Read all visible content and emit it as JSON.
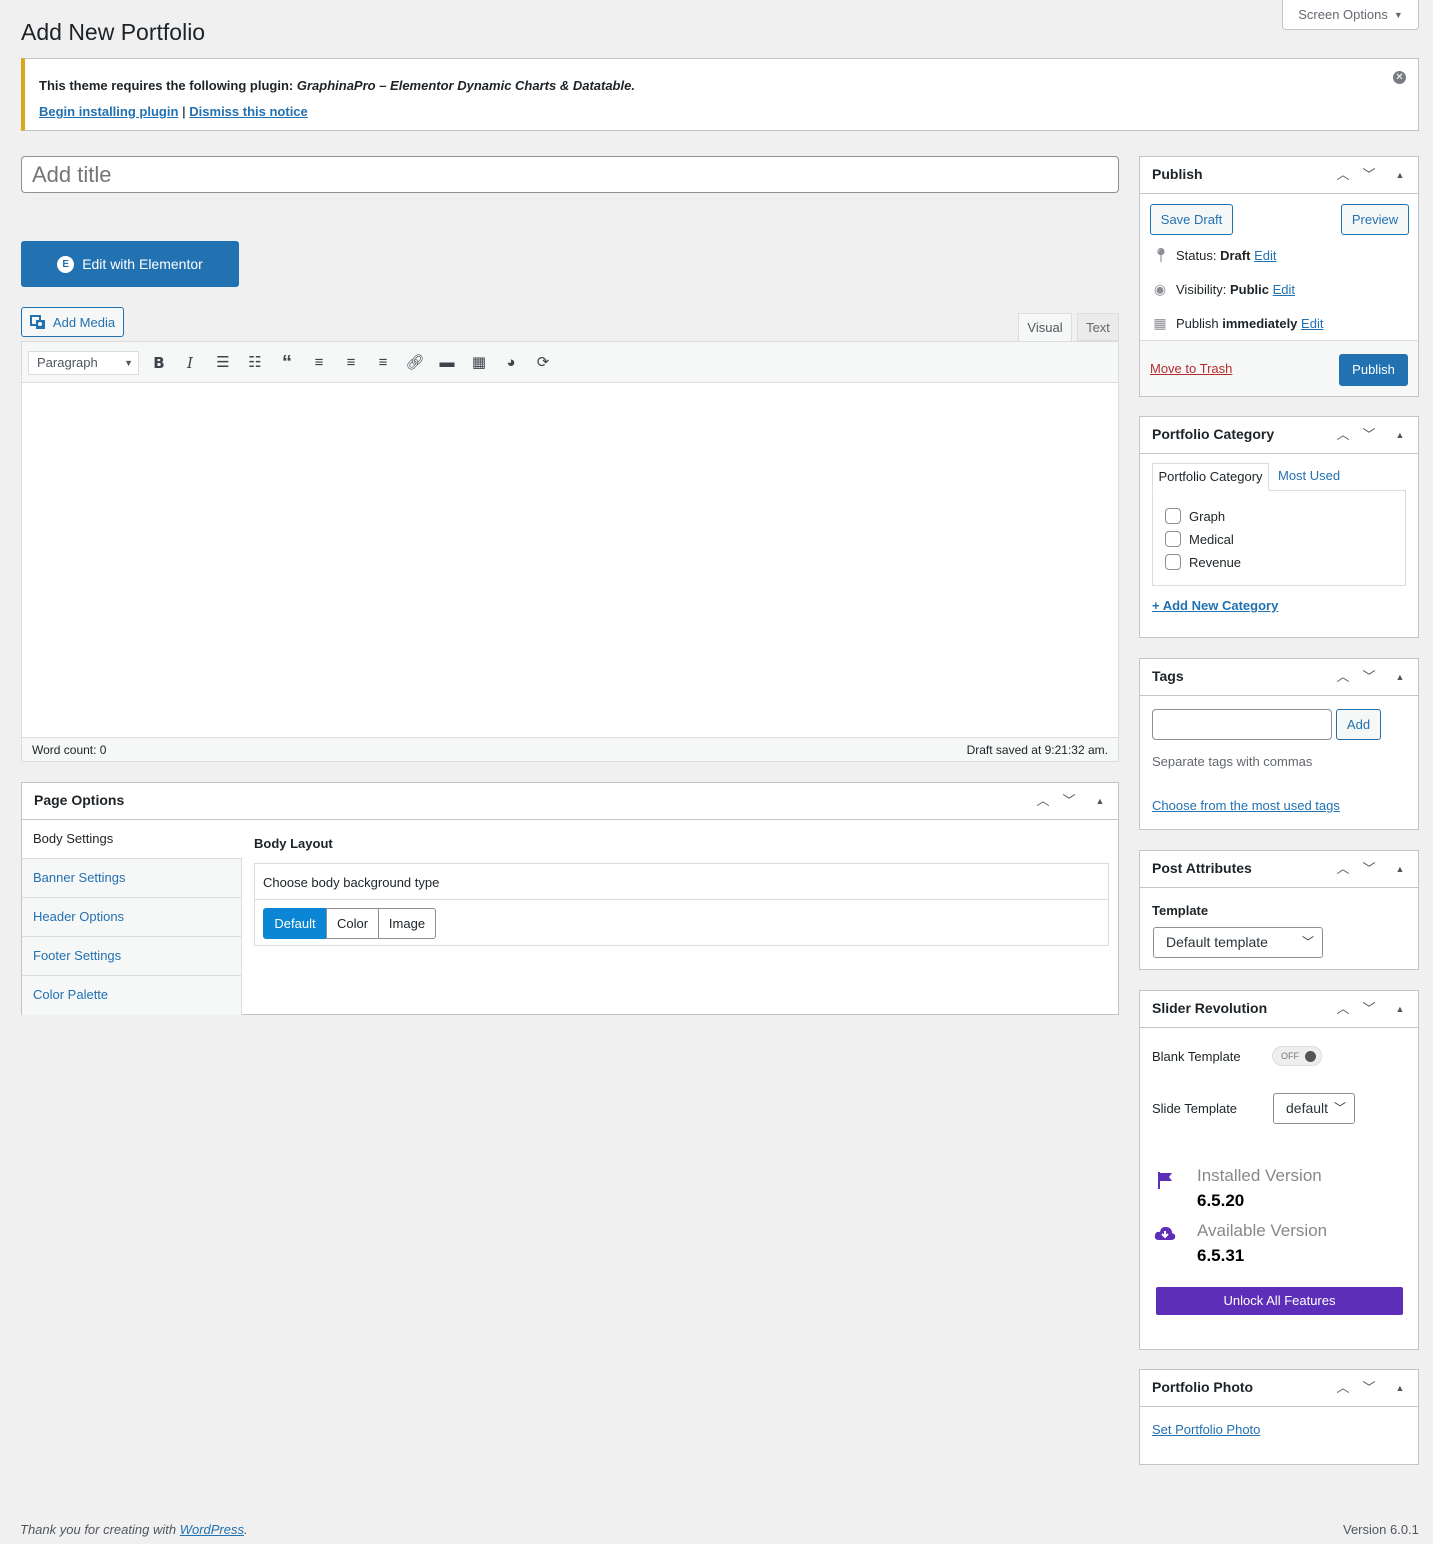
{
  "screen_options": {
    "label": "Screen Options",
    "arrow": "▼"
  },
  "page_title": "Add New Portfolio",
  "notice": {
    "prefix": "This theme requires the following plugin:",
    "plugin": "GraphinaPro – Elementor Dynamic Charts & Datatable.",
    "begin_link": "Begin installing plugin",
    "separator": "|",
    "dismiss_link": "Dismiss this notice"
  },
  "title_placeholder": "Add title",
  "elementor": {
    "label": "Edit with Elementor",
    "logo": "E"
  },
  "add_media": {
    "label": "Add Media",
    "icon": "media-icon"
  },
  "editor": {
    "tab_visual": "Visual",
    "tab_text": "Text",
    "format": "Paragraph",
    "toolbar_icons": [
      "bold",
      "italic",
      "bulleted-list",
      "numbered-list",
      "blockquote",
      "align-left",
      "align-center",
      "align-right",
      "link",
      "read-more",
      "toolbar-toggle",
      "chart",
      "refresh"
    ],
    "word_count": "Word count: 0",
    "draft_saved": "Draft saved at 9:21:32 am."
  },
  "page_options": {
    "title": "Page Options",
    "tabs": [
      "Body Settings",
      "Banner Settings",
      "Header Options",
      "Footer Settings",
      "Color Palette"
    ],
    "section_title": "Body Layout",
    "bg_label": "Choose body background type",
    "bg_options": [
      "Default",
      "Color",
      "Image"
    ],
    "bg_selected": "Default"
  },
  "publish": {
    "title": "Publish",
    "save_draft": "Save Draft",
    "preview": "Preview",
    "status_label": "Status:",
    "status_value": "Draft",
    "visibility_label": "Visibility:",
    "visibility_value": "Public",
    "publish_label": "Publish",
    "publish_value": "immediately",
    "edit": "Edit",
    "trash": "Move to Trash",
    "publish_btn": "Publish"
  },
  "category": {
    "title": "Portfolio Category",
    "tab_all": "Portfolio Category",
    "tab_used": "Most Used",
    "items": [
      "Graph",
      "Medical",
      "Revenue"
    ],
    "add_new": "+ Add New Category"
  },
  "tags": {
    "title": "Tags",
    "add": "Add",
    "hint": "Separate tags with commas",
    "choose": "Choose from the most used tags"
  },
  "post_attributes": {
    "title": "Post Attributes",
    "template_label": "Template",
    "template_value": "Default template"
  },
  "slider": {
    "title": "Slider Revolution",
    "blank_label": "Blank Template",
    "toggle": "OFF",
    "slide_label": "Slide Template",
    "slide_value": "default",
    "installed_label": "Installed Version",
    "installed_value": "6.5.20",
    "available_label": "Available Version",
    "available_value": "6.5.31",
    "unlock": "Unlock All Features",
    "accent": "#5d2eb7"
  },
  "photo": {
    "title": "Portfolio Photo",
    "link": "Set Portfolio Photo"
  },
  "footer": {
    "thanks": "Thank you for creating with",
    "wp": "WordPress",
    "period": ".",
    "version": "Version 6.0.1"
  }
}
